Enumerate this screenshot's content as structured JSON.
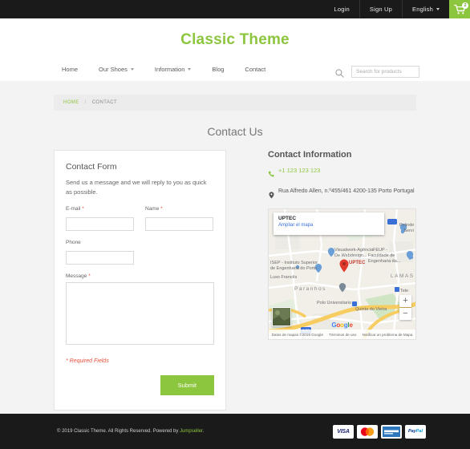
{
  "topbar": {
    "links": [
      {
        "label": "Login",
        "name": "login-link"
      },
      {
        "label": "Sign Up",
        "name": "signup-link"
      },
      {
        "label": "English",
        "name": "language-selector"
      }
    ],
    "cart": {
      "icon": "shopping-cart-icon",
      "count": "2"
    }
  },
  "header": {
    "logo": "Classic Theme",
    "nav": [
      {
        "label": "Home",
        "dropdown": false
      },
      {
        "label": "Our Shoes",
        "dropdown": true
      },
      {
        "label": "Information",
        "dropdown": true
      },
      {
        "label": "Blog",
        "dropdown": false
      },
      {
        "label": "Contact",
        "dropdown": false
      }
    ],
    "search": {
      "icon": "search-icon",
      "placeholder": "Search for products",
      "value": ""
    }
  },
  "breadcrumb": {
    "home": "HOME",
    "separator": "/",
    "current": "CONTACT"
  },
  "page_title": "Contact Us",
  "form": {
    "title": "Contact Form",
    "description": "Send us a message and we will reply to you as quick as possible.",
    "fields": {
      "email": {
        "label": "E-mail",
        "required": "*",
        "value": ""
      },
      "name": {
        "label": "Name",
        "required": "*",
        "value": ""
      },
      "phone": {
        "label": "Phone",
        "required": "",
        "value": ""
      },
      "message": {
        "label": "Message",
        "required": "*",
        "value": ""
      }
    },
    "required_note": "* Required Fields",
    "submit_label": "Submit"
  },
  "contact_info": {
    "title": "Contact Information",
    "phone_icon": "phone-icon",
    "phone": "+1 123 123 123",
    "address_icon": "map-pin-icon",
    "address": "Rua Alfredo Allen, n.º455/461 4200-135 Porto Portugal"
  },
  "map": {
    "info_window": {
      "title": "UPTEC",
      "link": "Ampliar el mapa"
    },
    "marker_label": "UPTEC",
    "labels": [
      "Visualwork-Agência",
      "De Webdesign...",
      "ISEP - Instituto Superior",
      "de Engenharia do Porto",
      "FEUP -",
      "Faculdade de",
      "Engenharia da...",
      "Luso Francês",
      "Paranhos",
      "LAMAS",
      "Polo Universitario",
      "Quinta do Vieira",
      "Polinde",
      "- Servi",
      "Tele",
      "A20"
    ],
    "zoom_in": "+",
    "zoom_out": "−",
    "google_logo": "Google",
    "attribution": [
      "Datos de mapas ©2019 Google",
      "Términos de uso",
      "Notificar un problema de Mapa"
    ]
  },
  "footer": {
    "copyright_pre": "© 2019 Classic Theme. All Rights Reserved. Powered by ",
    "powered_by": "Jumpseller",
    "copyright_post": ".",
    "payments": [
      {
        "name": "visa-icon",
        "label": "VISA"
      },
      {
        "name": "mastercard-icon",
        "label": ""
      },
      {
        "name": "amex-icon",
        "label": ""
      },
      {
        "name": "paypal-icon",
        "label": "PayPal"
      }
    ]
  },
  "colors": {
    "accent_green": "#8cc63e",
    "dark": "#1a1a1a",
    "required_red": "#e8503a",
    "body_bg": "#f3f3f3"
  }
}
